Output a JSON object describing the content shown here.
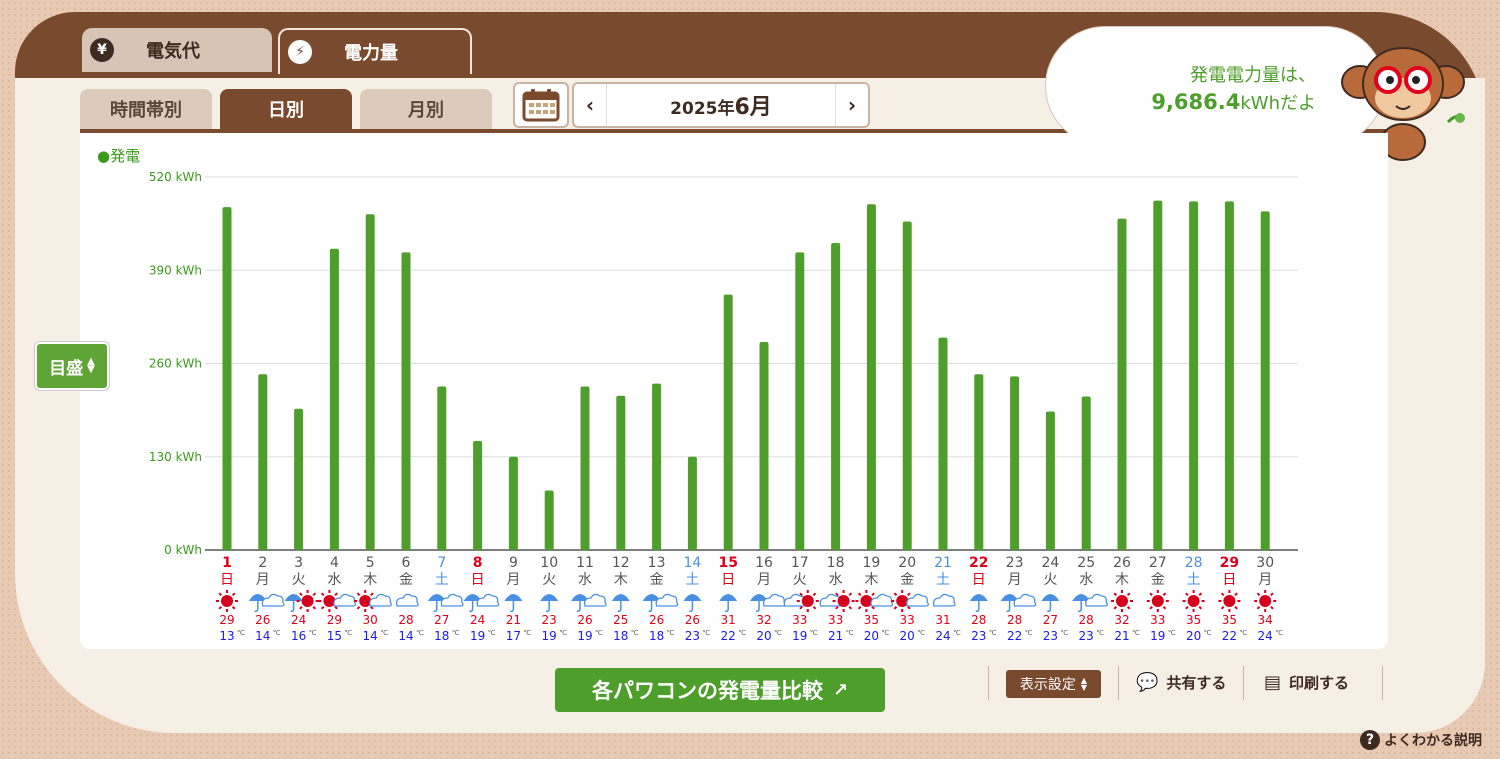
{
  "top_tabs": [
    {
      "label": "電気代",
      "icon": "¥"
    },
    {
      "label": "電力量",
      "icon": "⚡"
    }
  ],
  "sub_tabs": [
    "時間帯別",
    "日別",
    "月別"
  ],
  "date": {
    "prefix": "2025年",
    "month": "6月"
  },
  "bubble": {
    "line1": "発電電力量は、",
    "value": "9,686.4",
    "unit_suffix": "kWhだよ"
  },
  "legend": "発電",
  "scale_button": "目盛",
  "compare_button": "各パワコンの発電量比較",
  "display_settings": "表示設定",
  "share": "共有する",
  "print": "印刷する",
  "help": "よくわかる説明",
  "colors": {
    "bar": "#4d9e2a",
    "sunday": "#e0001a",
    "saturday": "#4a90e2",
    "high": "#e0001a",
    "low": "#1a1aee"
  },
  "chart_data": {
    "type": "bar",
    "ylabel": "",
    "ylim": [
      0,
      520
    ],
    "yticks": [
      "0 kWh",
      "130 kWh",
      "260 kWh",
      "390 kWh",
      "520 kWh"
    ],
    "series": [
      {
        "name": "発電",
        "values": [
          478,
          245,
          197,
          420,
          468,
          415,
          228,
          152,
          130,
          83,
          228,
          215,
          232,
          130,
          356,
          290,
          415,
          428,
          482,
          458,
          296,
          245,
          242,
          193,
          214,
          462,
          487,
          486,
          486,
          472
        ]
      }
    ],
    "days": [
      "1",
      "2",
      "3",
      "4",
      "5",
      "6",
      "7",
      "8",
      "9",
      "10",
      "11",
      "12",
      "13",
      "14",
      "15",
      "16",
      "17",
      "18",
      "19",
      "20",
      "21",
      "22",
      "23",
      "24",
      "25",
      "26",
      "27",
      "28",
      "29",
      "30"
    ],
    "weekdays": [
      "日",
      "月",
      "火",
      "水",
      "木",
      "金",
      "土",
      "日",
      "月",
      "火",
      "水",
      "木",
      "金",
      "土",
      "日",
      "月",
      "火",
      "水",
      "木",
      "金",
      "土",
      "日",
      "月",
      "火",
      "水",
      "木",
      "金",
      "土",
      "日",
      "月"
    ],
    "day_type": [
      "sun",
      "wd",
      "wd",
      "wd",
      "wd",
      "wd",
      "sat",
      "sun",
      "wd",
      "wd",
      "wd",
      "wd",
      "wd",
      "sat",
      "sun",
      "wd",
      "wd",
      "wd",
      "wd",
      "wd",
      "sat",
      "sun",
      "wd",
      "wd",
      "wd",
      "wd",
      "wd",
      "sat",
      "sun",
      "wd"
    ],
    "weather": [
      "sunny",
      "rain-cloudy",
      "rain-sunny",
      "sunny-cloudy",
      "sunny-cloudy",
      "cloudy",
      "rain-cloudy",
      "rain-cloudy",
      "rain",
      "rain",
      "rain-cloudy",
      "rain",
      "rain-cloudy",
      "rain",
      "rain",
      "rain-cloudy",
      "cloudy-sunny",
      "cloudy-sunny",
      "sunny-cloudy",
      "sunny-cloudy",
      "cloudy",
      "rain",
      "rain-cloudy",
      "rain",
      "rain-cloudy",
      "sunny",
      "sunny",
      "sunny",
      "sunny",
      "sunny"
    ],
    "high_temp": [
      "29",
      "26",
      "24",
      "29",
      "30",
      "28",
      "27",
      "24",
      "21",
      "23",
      "26",
      "25",
      "26",
      "26",
      "31",
      "32",
      "33",
      "33",
      "35",
      "33",
      "31",
      "28",
      "28",
      "27",
      "28",
      "32",
      "33",
      "35",
      "35",
      "34"
    ],
    "low_temp": [
      "13",
      "14",
      "16",
      "15",
      "14",
      "14",
      "18",
      "19",
      "17",
      "19",
      "19",
      "18",
      "18",
      "23",
      "22",
      "20",
      "19",
      "21",
      "20",
      "20",
      "24",
      "23",
      "22",
      "23",
      "23",
      "21",
      "19",
      "20",
      "22",
      "24"
    ],
    "temp_unit": "℃"
  }
}
